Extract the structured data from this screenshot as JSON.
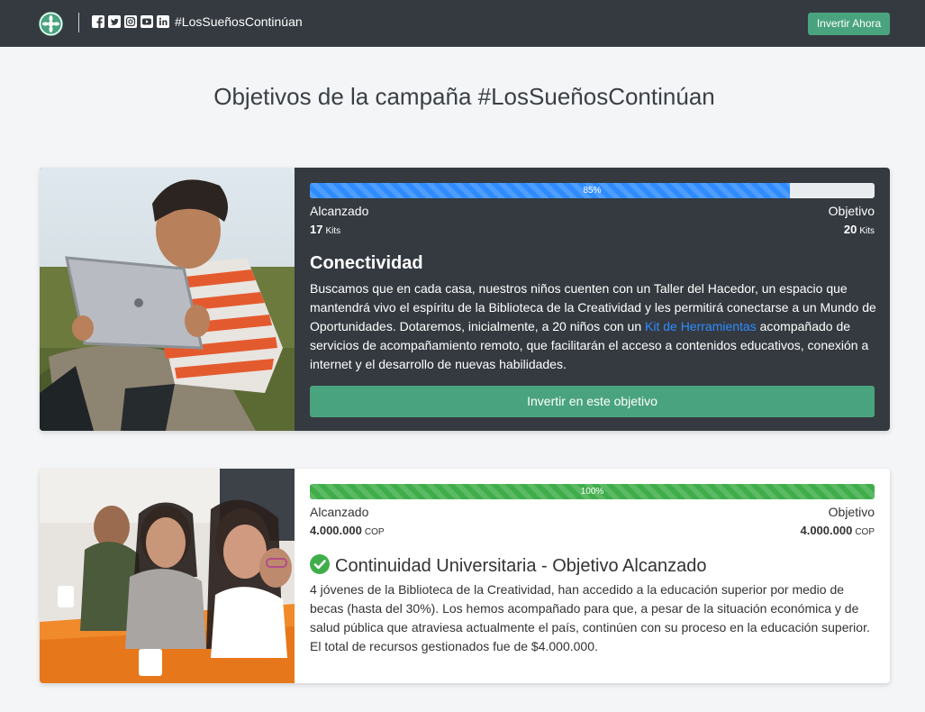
{
  "navbar": {
    "hashtag": "#LosSueñosContinúan",
    "invest_button": "Invertir Ahora",
    "social_icons": [
      "facebook-icon",
      "twitter-icon",
      "instagram-icon",
      "youtube-icon",
      "linkedin-icon"
    ]
  },
  "page": {
    "title": "Objetivos de la campaña #LosSueñosContinúan"
  },
  "colors": {
    "navbar": "#343a40",
    "accent": "#4aa37f",
    "progress_blue": "#2f8cff",
    "progress_green": "#3fae4a",
    "link": "#2f8cff"
  },
  "goals": [
    {
      "progress_value": 0.85,
      "progress_label": "85%",
      "achieved_label": "Alcanzado",
      "achieved_value": "17",
      "achieved_unit": "Kits",
      "target_label": "Objetivo",
      "target_value": "20",
      "target_unit": "Kits",
      "heading": "Conectividad",
      "body_before_link": "Buscamos que en cada casa, nuestros niños cuenten con un Taller del Hacedor, un espacio que mantendrá vivo el espíritu de la Biblioteca de la Creatividad y les permitirá conectarse a un Mundo de Oportunidades. Dotaremos, inicialmente, a 20 niños con un ",
      "body_link": "Kit de Herramientas",
      "body_after_link": " acompañado de servicios de acompañamiento remoto, que facilitarán el acceso a contenidos educativos, conexión a internet y el desarrollo de nuevas habilidades.",
      "button": "Invertir en este objetivo"
    },
    {
      "progress_value": 1.0,
      "progress_label": "100%",
      "achieved_label": "Alcanzado",
      "achieved_value": "4.000.000",
      "achieved_unit": "COP",
      "target_label": "Objetivo",
      "target_value": "4.000.000",
      "target_unit": "COP",
      "heading": "Continuidad Universitaria - Objetivo Alcanzado",
      "body": "4 jóvenes de la Biblioteca de la Creatividad, han accedido a la educación superior por medio de becas (hasta del 30%). Los hemos acompañado para que, a pesar de la situación económica y de salud pública que atraviesa actualmente el país, continúen con su proceso en la educación superior. El total de recursos gestionados fue de $4.000.000."
    }
  ]
}
